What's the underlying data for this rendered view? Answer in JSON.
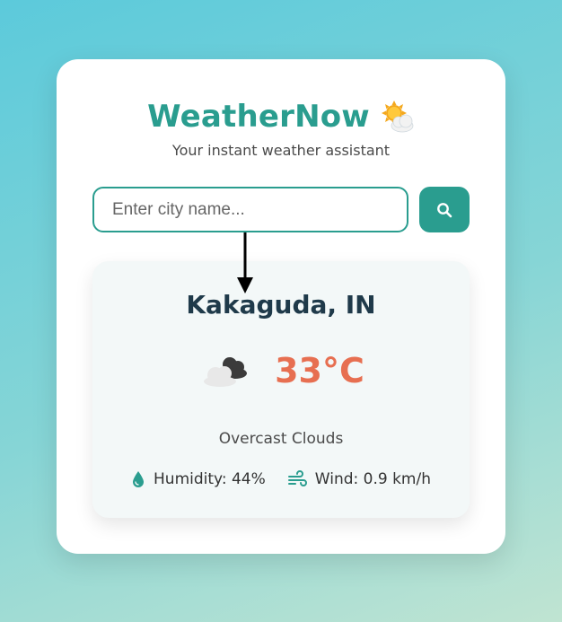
{
  "header": {
    "title": "WeatherNow",
    "logo_icon": "sun-behind-cloud-icon",
    "subtitle": "Your instant weather assistant"
  },
  "search": {
    "placeholder": "Enter city name...",
    "value": "",
    "button_icon": "search-icon"
  },
  "weather": {
    "city": "Kakaguda, IN",
    "condition_icon": "overcast-clouds-icon",
    "temperature": "33°C",
    "description": "Overcast Clouds",
    "humidity_label": "Humidity: 44%",
    "humidity_icon": "water-drop-icon",
    "wind_label": "Wind: 0.9 km/h",
    "wind_icon": "wind-icon"
  },
  "colors": {
    "accent": "#2a9d8f",
    "temperature": "#e76f51",
    "city": "#1f3a4a",
    "background_top": "#5ccadb",
    "background_bottom": "#c0e4d2"
  }
}
